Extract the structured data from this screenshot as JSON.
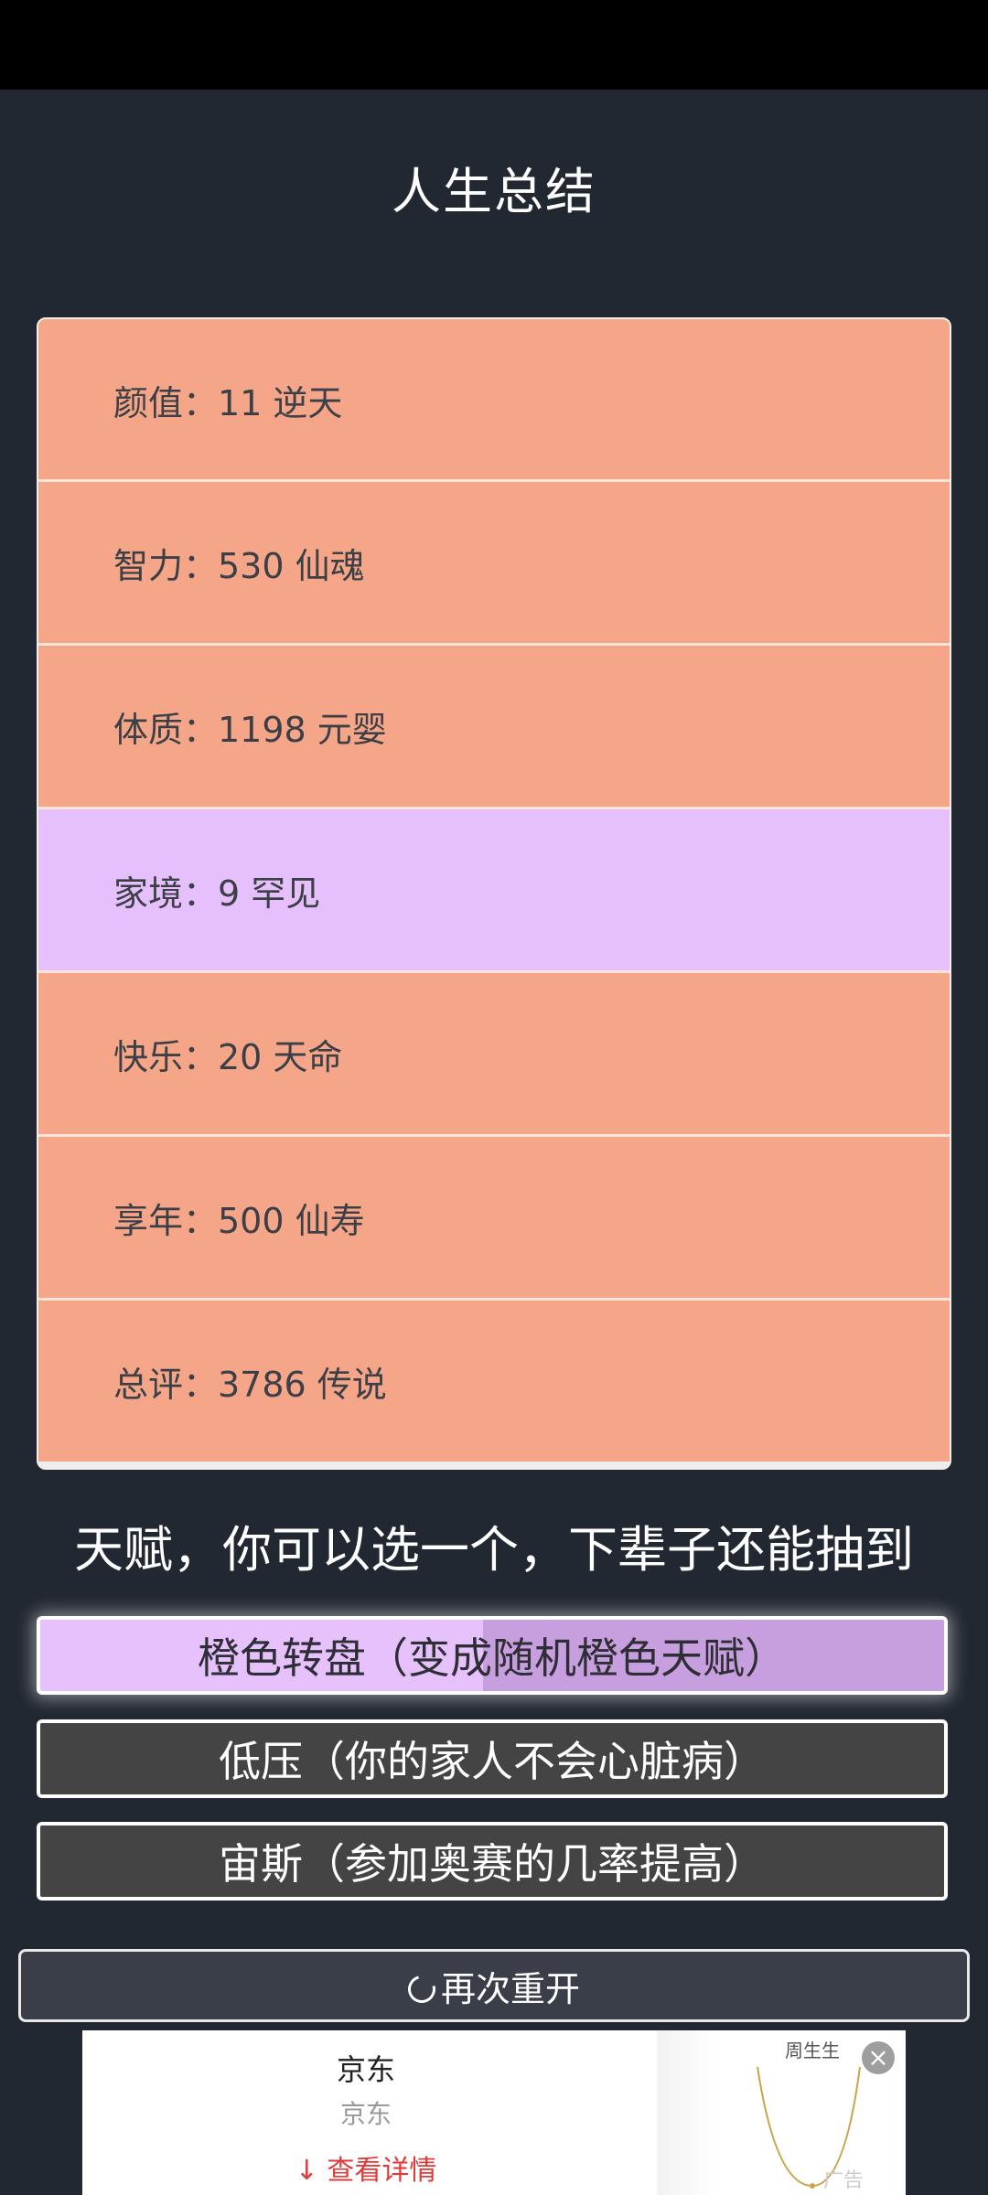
{
  "header": {
    "title": "人生总结"
  },
  "stats": [
    {
      "label": "颜值：11 逆天",
      "variant": "orange"
    },
    {
      "label": "智力：530 仙魂",
      "variant": "orange"
    },
    {
      "label": "体质：1198 元婴",
      "variant": "orange"
    },
    {
      "label": "家境：9 罕见",
      "variant": "purple"
    },
    {
      "label": "快乐：20 天命",
      "variant": "orange"
    },
    {
      "label": "享年：500 仙寿",
      "variant": "orange"
    },
    {
      "label": "总评：3786 传说",
      "variant": "orange"
    }
  ],
  "talents": {
    "heading": "天赋，你可以选一个，下辈子还能抽到",
    "options": [
      {
        "label": "橙色转盘（变成随机橙色天赋）",
        "selected": true
      },
      {
        "label": "低压（你的家人不会心脏病）",
        "selected": false
      },
      {
        "label": "宙斯（参加奥赛的几率提高）",
        "selected": false
      }
    ]
  },
  "actions": {
    "restart_label": "再次重开"
  },
  "ad": {
    "title": "京东",
    "subtitle": "京东",
    "link_label": "查看详情",
    "brand_text": "周生生",
    "tag": "广告",
    "close_icon": "close-icon"
  },
  "colors": {
    "background": "#222831",
    "stat_orange": "#f6a688",
    "stat_purple": "#e5c0fc",
    "talent_default": "#444444",
    "talent_selected": "#e6c1fc",
    "ad_link": "#e03a3a"
  }
}
